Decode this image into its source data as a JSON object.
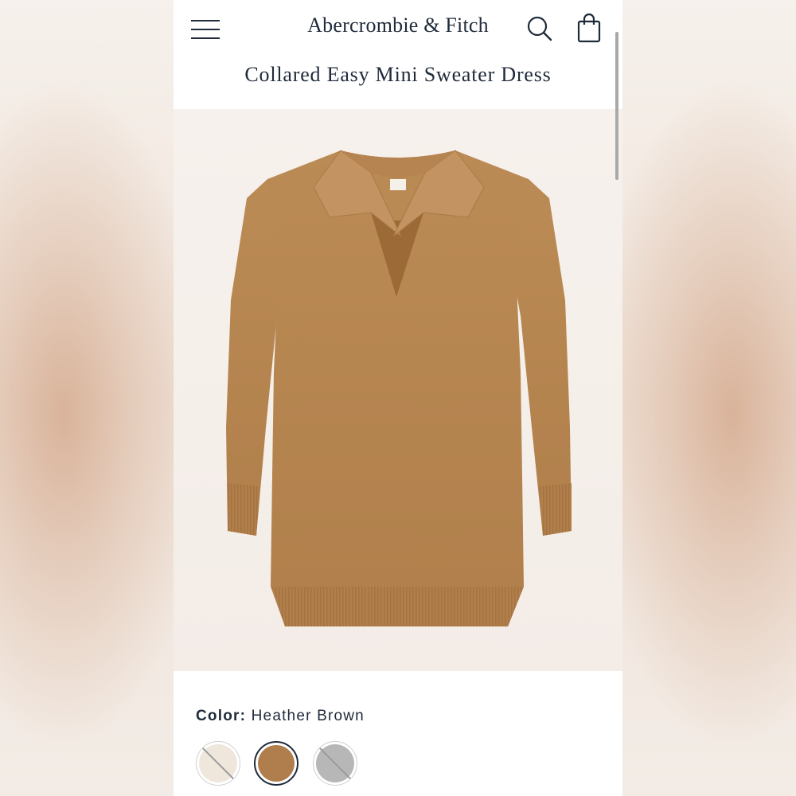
{
  "header": {
    "brand": "Abercrombie & Fitch",
    "icons": {
      "menu": "menu-icon",
      "search": "search-icon",
      "bag": "shopping-bag-icon"
    }
  },
  "product": {
    "title": "Collared Easy Mini Sweater Dress",
    "image_alt_icon": "sweater-dress-image"
  },
  "color": {
    "label": "Color:",
    "selected": "Heather Brown",
    "swatches": [
      {
        "color": "#efe7dc",
        "selected": false,
        "crossed_out": true
      },
      {
        "color": "#b07e4d",
        "selected": true,
        "crossed_out": false
      },
      {
        "color": "#b7b7b7",
        "selected": false,
        "crossed_out": true
      }
    ]
  },
  "colors": {
    "text": "#1f2a3a",
    "dress": "#b8874f",
    "accent_border": "#1f2a3a"
  }
}
